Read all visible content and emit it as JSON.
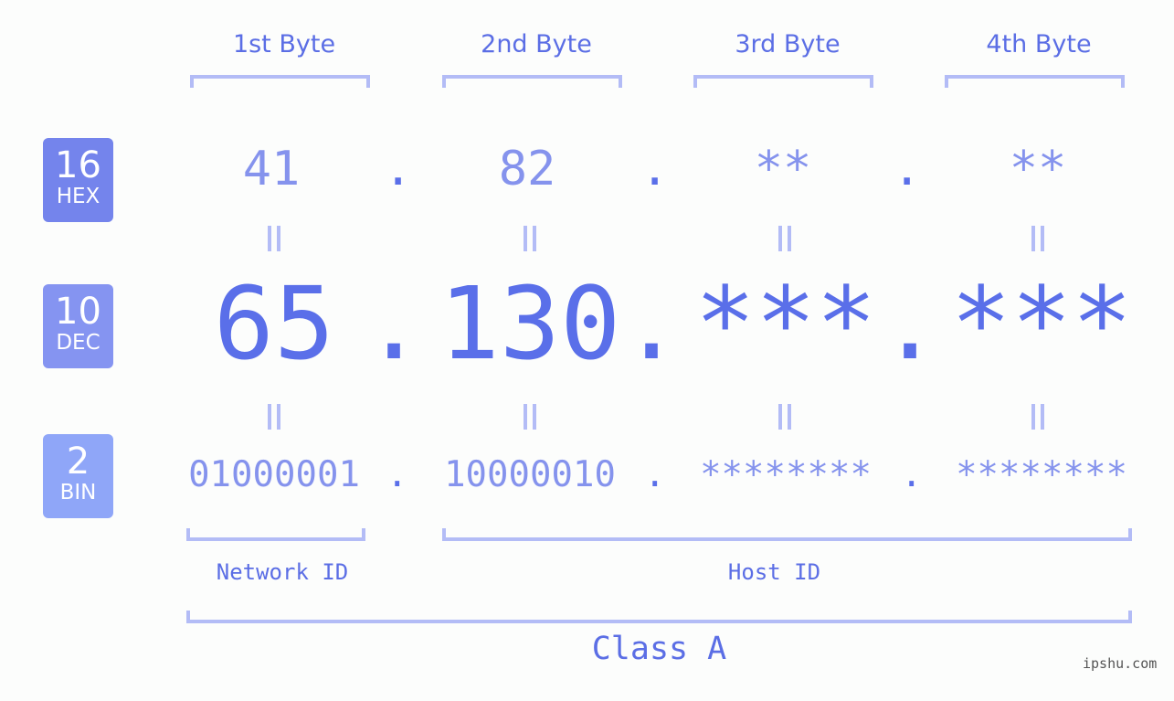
{
  "bytes": [
    {
      "label": "1st Byte",
      "hex": "41",
      "dec": "65",
      "bin": "01000001"
    },
    {
      "label": "2nd Byte",
      "hex": "82",
      "dec": "130",
      "bin": "10000010"
    },
    {
      "label": "3rd Byte",
      "hex": "**",
      "dec": "***",
      "bin": "********"
    },
    {
      "label": "4th Byte",
      "hex": "**",
      "dec": "***",
      "bin": "********"
    }
  ],
  "separator": ".",
  "bases": {
    "hex": {
      "num": "16",
      "label": "HEX",
      "color": "#7484ec"
    },
    "dec": {
      "num": "10",
      "label": "DEC",
      "color": "#8594f1"
    },
    "bin": {
      "num": "2",
      "label": "BIN",
      "color": "#8fa6f8"
    }
  },
  "segments": {
    "network": "Network ID",
    "host": "Host ID"
  },
  "class_label": "Class A",
  "watermark": "ipshu.com"
}
